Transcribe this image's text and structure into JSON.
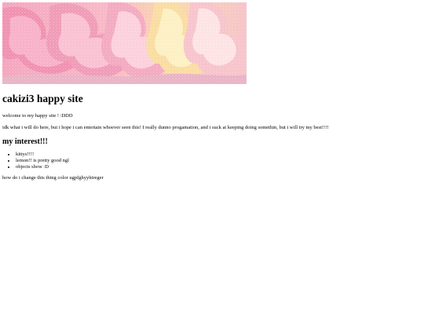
{
  "banner": {
    "icon": "pink-candy-banner-image",
    "colors": [
      "#f4a3b8",
      "#fbe7a2",
      "#f7c6cf"
    ]
  },
  "site_title": "cakizi3 happy site",
  "welcome_text": "welcome to my happy site ! :DDD",
  "intro_text": "idk what i will do here, but i hope i can entertain whoever seen this! I really dunno progamation, and i suck at keeping doing somethin, but i will try my best!!!!",
  "interests": {
    "heading": "my interest!!!",
    "items": [
      "kittys!!!!",
      "lemon!! is pretty good ngl",
      "objects show :D"
    ]
  },
  "question_text": "how do i change this thing color ugpfghyyhtreger"
}
